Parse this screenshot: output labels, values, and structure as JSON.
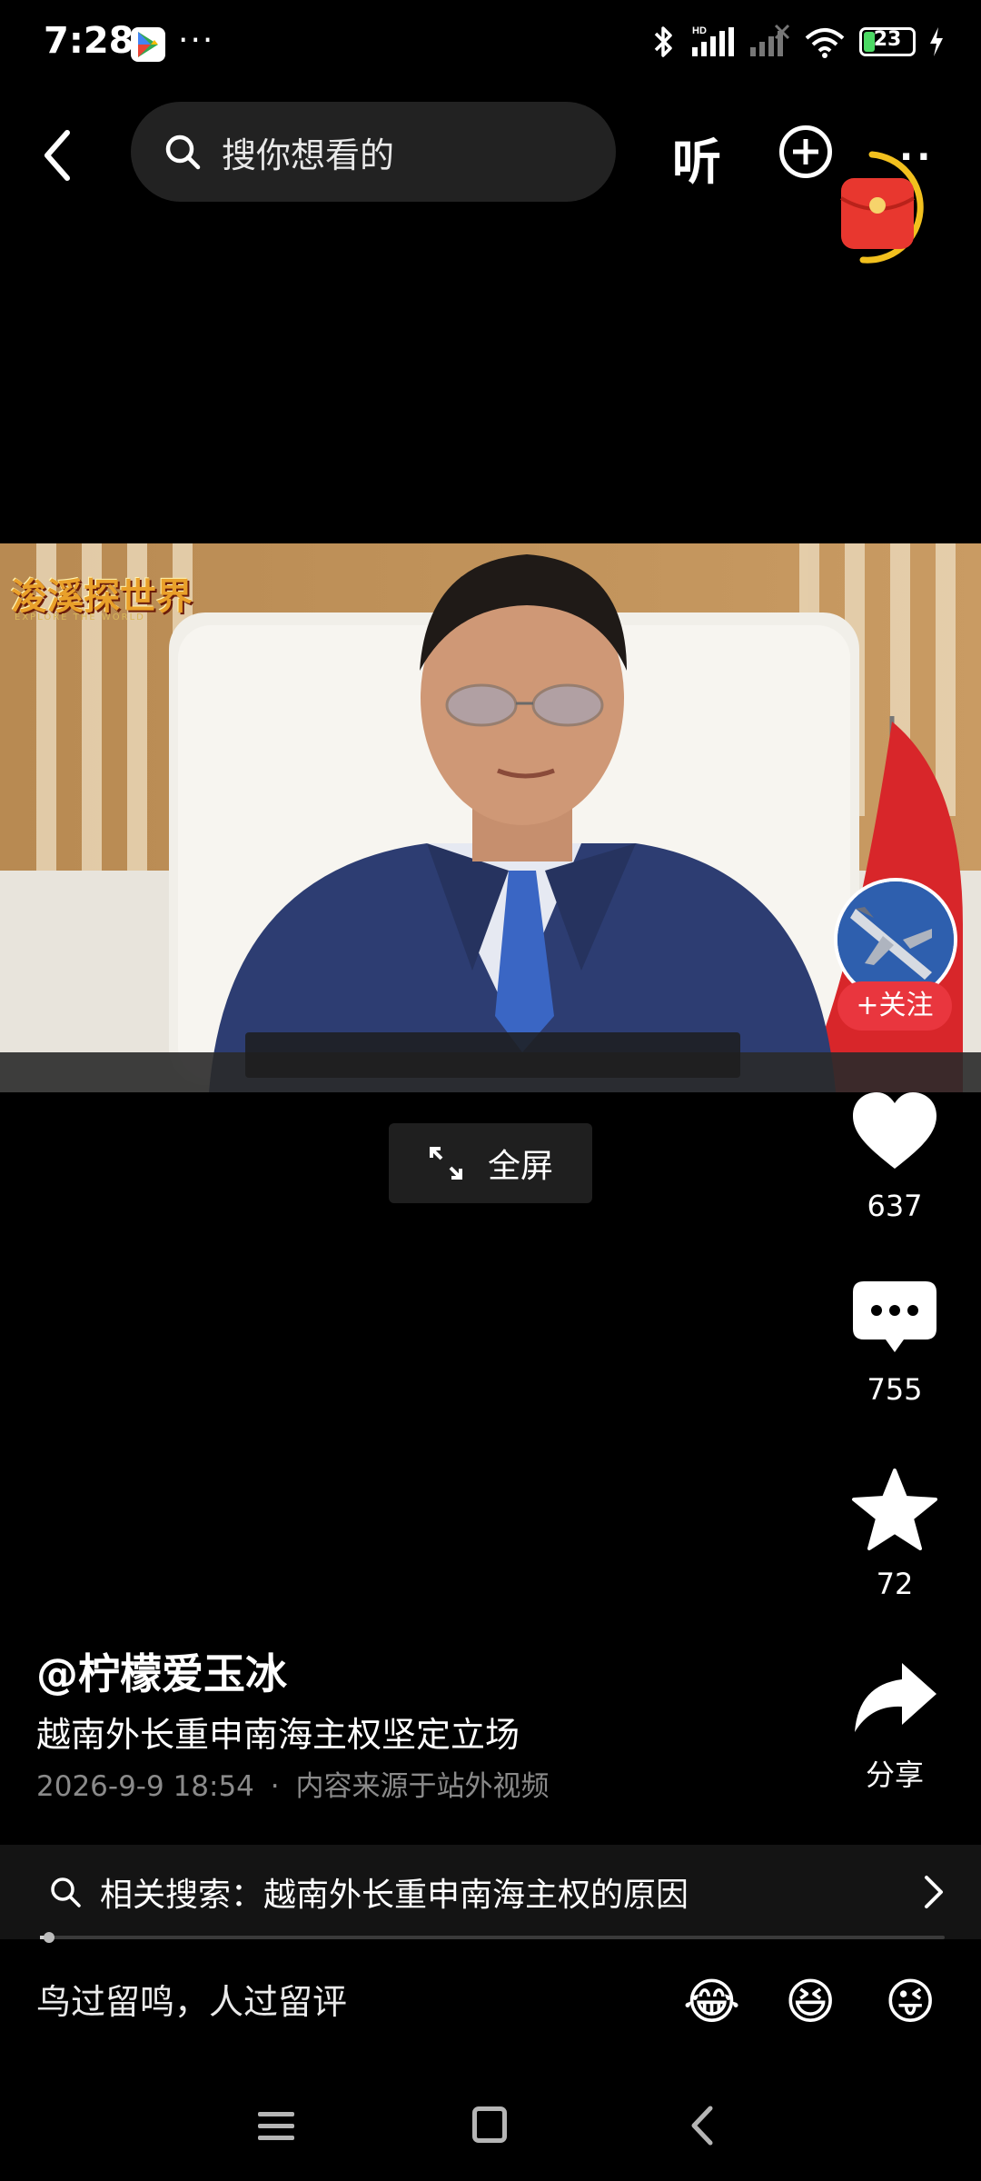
{
  "status_bar": {
    "time": "7:28",
    "more": "···",
    "battery": "23"
  },
  "header": {
    "search_placeholder": "搜你想看的",
    "listen_label": "听",
    "more_label": "··"
  },
  "video": {
    "logo_text": "浚溪探世界",
    "logo_sub": "EXPLORE THE WORLD"
  },
  "fullscreen": {
    "label": "全屏"
  },
  "actions": {
    "follow_label": "+关注",
    "likes": "637",
    "comments": "755",
    "favorites": "72",
    "share_label": "分享"
  },
  "caption": {
    "author": "@柠檬爱玉冰",
    "title": "越南外长重申南海主权坚定立场",
    "date": "2026-9-9 18:54",
    "separator": "·",
    "source": "内容来源于站外视频"
  },
  "related_search": {
    "text": "相关搜索：越南外长重申南海主权的原因"
  },
  "comment_bar": {
    "placeholder": "鸟过留鸣，人过留评",
    "emojis": [
      "😂",
      "😆",
      "😜"
    ]
  },
  "progress": 0.01,
  "colors": {
    "background": "#000000",
    "accent_red": "#e9363e",
    "meta_gray": "#8a8a8a",
    "battery_green": "#4cd964"
  }
}
